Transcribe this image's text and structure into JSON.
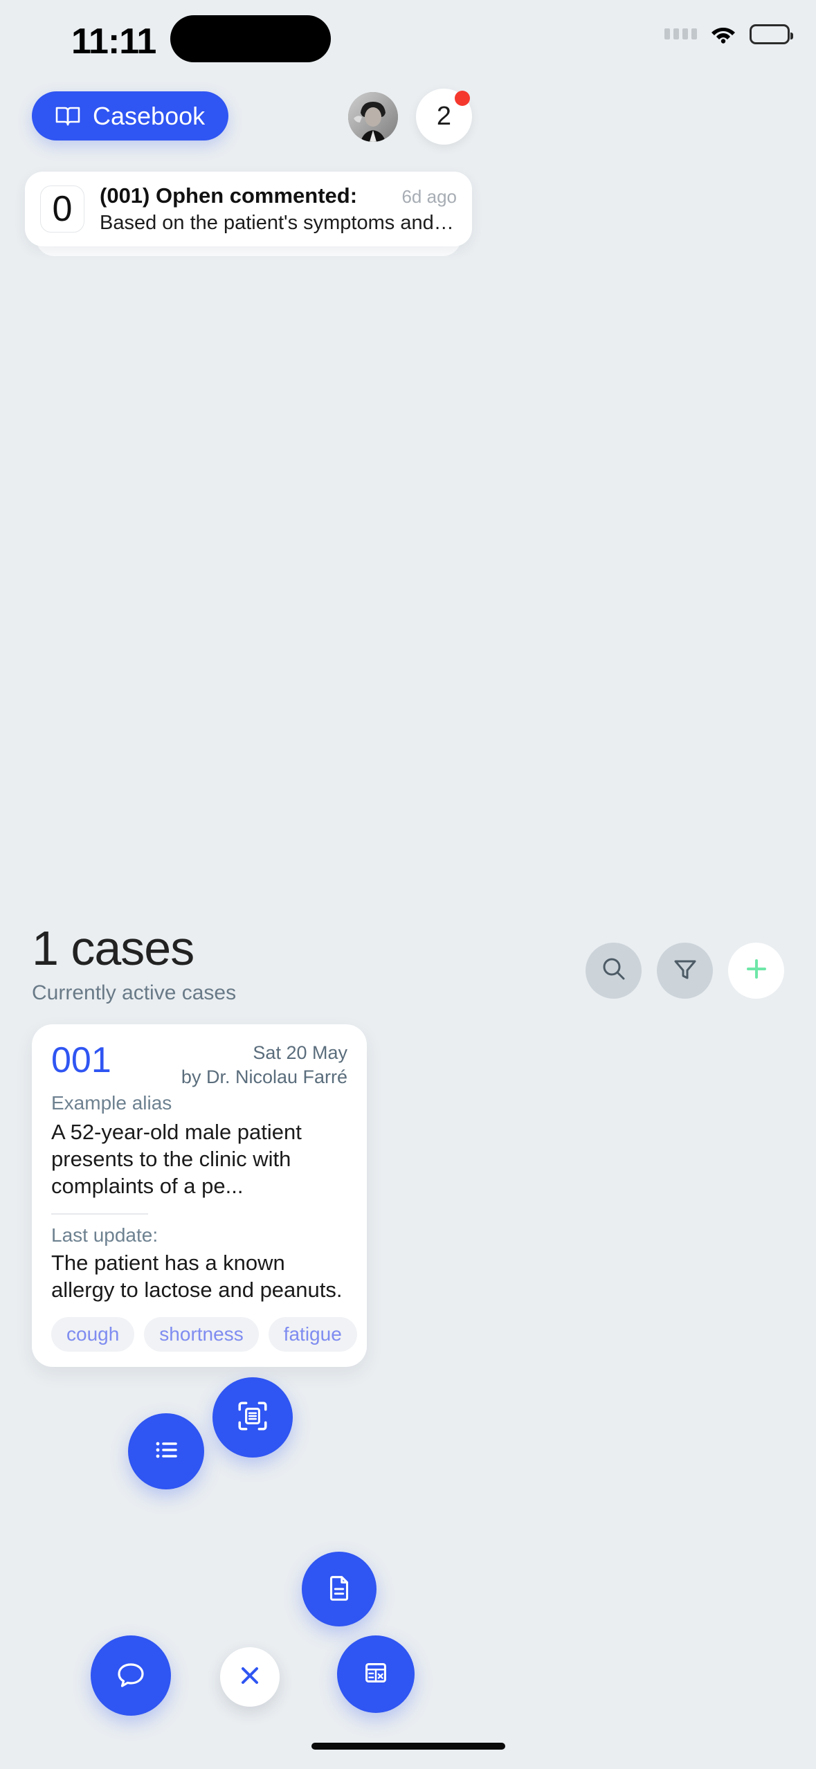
{
  "statusbar": {
    "time": "11:11",
    "signal_icon": "signal-dots-icon",
    "wifi_icon": "wifi-icon",
    "battery_icon": "battery-icon"
  },
  "header": {
    "casebook_label": "Casebook",
    "casebook_icon": "book-open-icon",
    "avatar_name": "user-avatar",
    "notification_count": "2",
    "notification_has_alert": true,
    "accent_blue": "#2f55f2",
    "alert_red": "#f4382e"
  },
  "notification": {
    "badge": "0",
    "title": "(001) Ophen commented:",
    "time": "6d ago",
    "preview": "Based on the patient's symptoms and history, ther..."
  },
  "cases_section": {
    "count_label": "1 cases",
    "subtitle": "Currently active cases",
    "actions": [
      {
        "name": "search-button",
        "icon": "search-icon",
        "style": "gray"
      },
      {
        "name": "filter-button",
        "icon": "funnel-icon",
        "style": "gray"
      },
      {
        "name": "add-case-button",
        "icon": "plus-icon",
        "style": "white"
      }
    ],
    "plus_color": "#6ee7a8"
  },
  "case_card": {
    "id": "001",
    "date": "Sat 20 May",
    "author": "by Dr. Nicolau Farré",
    "alias": "Example alias",
    "description": "A 52-year-old male patient presents to the clinic with complaints of a pe...",
    "last_update_label": "Last update:",
    "last_update_text": "The patient has a known allergy to lactose and peanuts.",
    "tags": [
      "cough",
      "shortness",
      "fatigue"
    ]
  },
  "fab_menu": {
    "items": [
      {
        "name": "fab-list-button",
        "icon": "list-icon"
      },
      {
        "name": "fab-scan-button",
        "icon": "scan-document-icon"
      },
      {
        "name": "fab-document-button",
        "icon": "file-text-icon"
      },
      {
        "name": "fab-chat-button",
        "icon": "chat-bubble-icon"
      },
      {
        "name": "fab-close-button",
        "icon": "close-x-icon"
      },
      {
        "name": "fab-form-button",
        "icon": "form-grid-icon"
      }
    ],
    "close_icon_color": "#2f55f2"
  }
}
